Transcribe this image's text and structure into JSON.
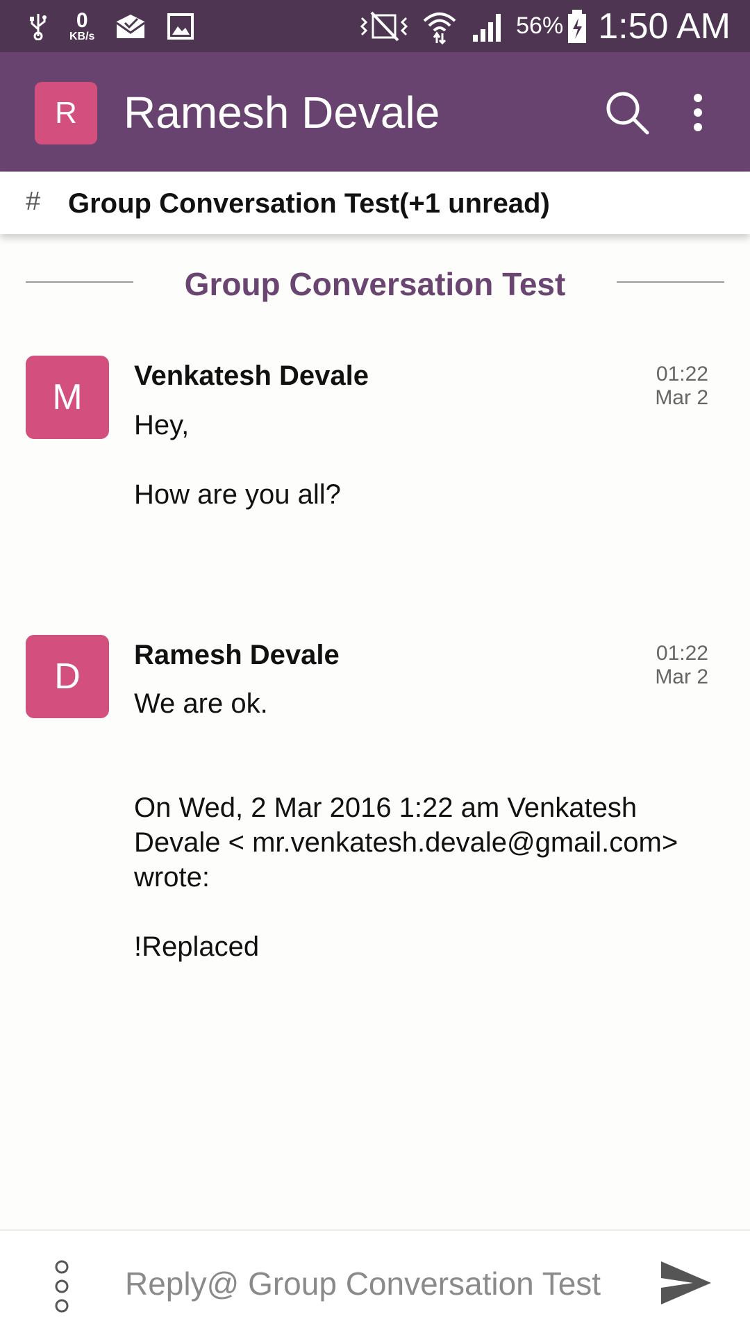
{
  "status_bar": {
    "kb_value": "0",
    "kb_unit": "KB/s",
    "battery_percent": "56%",
    "time": "1:50 AM",
    "icons": [
      "usb-icon",
      "mail-icon",
      "gallery-icon",
      "vibrate-icon",
      "wifi-icon",
      "signal-icon",
      "battery-charging-icon"
    ]
  },
  "app_bar": {
    "avatar_letter": "R",
    "title": "Ramesh Devale",
    "icons": [
      "search-icon",
      "more-vert-icon"
    ]
  },
  "channel": {
    "hash": "#",
    "title": "Group Conversation Test(+1 unread)"
  },
  "conversation": {
    "heading": "Group Conversation Test",
    "messages": [
      {
        "avatar_letter": "M",
        "sender": "Venkatesh Devale",
        "time": "01:22",
        "date": "Mar 2",
        "lines": [
          "Hey,",
          "How are you all?"
        ]
      },
      {
        "avatar_letter": "D",
        "sender": "Ramesh Devale",
        "time": "01:22",
        "date": "Mar 2",
        "lines": [
          "We are ok.",
          "On Wed, 2 Mar 2016 1:22 am Venkatesh",
          "Devale < mr.venkatesh.devale@gmail.com>",
          "wrote:",
          "!Replaced"
        ]
      }
    ]
  },
  "footer": {
    "placeholder": "Reply@ Group Conversation Test",
    "icons": [
      "attach-options-icon",
      "send-icon"
    ]
  },
  "colors": {
    "status_bar": "#4e3652",
    "app_bar": "#694370",
    "avatar": "#d24f7e",
    "heading": "#6a4572",
    "background": "#fdfdfb"
  }
}
